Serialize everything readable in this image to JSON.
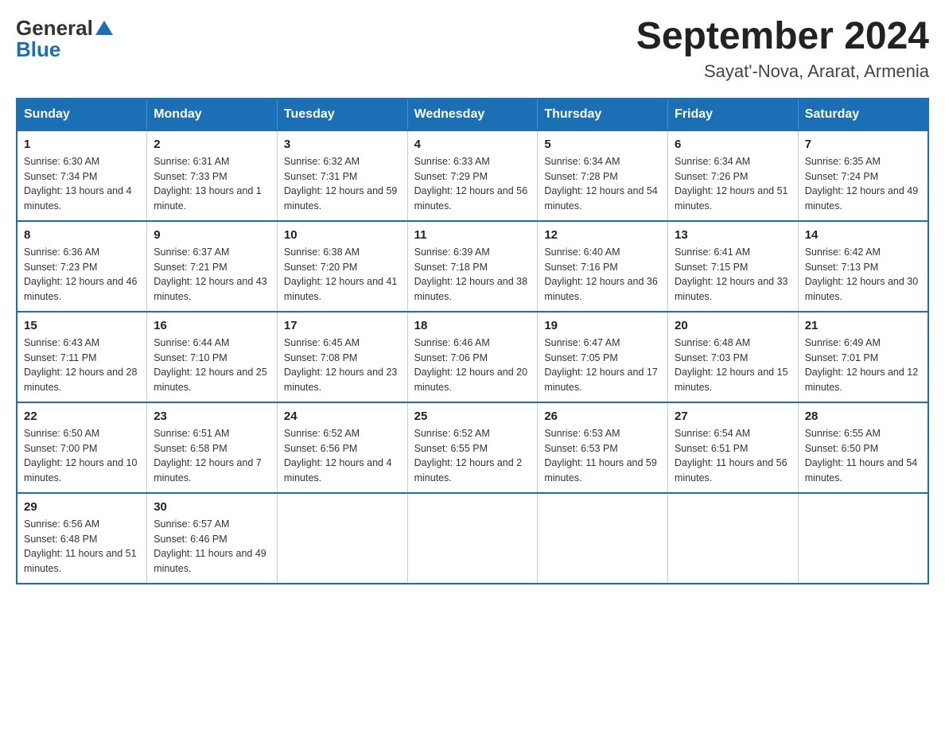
{
  "logo": {
    "general": "General",
    "blue": "Blue"
  },
  "title": "September 2024",
  "location": "Sayat'-Nova, Ararat, Armenia",
  "days_header": [
    "Sunday",
    "Monday",
    "Tuesday",
    "Wednesday",
    "Thursday",
    "Friday",
    "Saturday"
  ],
  "weeks": [
    [
      {
        "day": "1",
        "sunrise": "Sunrise: 6:30 AM",
        "sunset": "Sunset: 7:34 PM",
        "daylight": "Daylight: 13 hours and 4 minutes."
      },
      {
        "day": "2",
        "sunrise": "Sunrise: 6:31 AM",
        "sunset": "Sunset: 7:33 PM",
        "daylight": "Daylight: 13 hours and 1 minute."
      },
      {
        "day": "3",
        "sunrise": "Sunrise: 6:32 AM",
        "sunset": "Sunset: 7:31 PM",
        "daylight": "Daylight: 12 hours and 59 minutes."
      },
      {
        "day": "4",
        "sunrise": "Sunrise: 6:33 AM",
        "sunset": "Sunset: 7:29 PM",
        "daylight": "Daylight: 12 hours and 56 minutes."
      },
      {
        "day": "5",
        "sunrise": "Sunrise: 6:34 AM",
        "sunset": "Sunset: 7:28 PM",
        "daylight": "Daylight: 12 hours and 54 minutes."
      },
      {
        "day": "6",
        "sunrise": "Sunrise: 6:34 AM",
        "sunset": "Sunset: 7:26 PM",
        "daylight": "Daylight: 12 hours and 51 minutes."
      },
      {
        "day": "7",
        "sunrise": "Sunrise: 6:35 AM",
        "sunset": "Sunset: 7:24 PM",
        "daylight": "Daylight: 12 hours and 49 minutes."
      }
    ],
    [
      {
        "day": "8",
        "sunrise": "Sunrise: 6:36 AM",
        "sunset": "Sunset: 7:23 PM",
        "daylight": "Daylight: 12 hours and 46 minutes."
      },
      {
        "day": "9",
        "sunrise": "Sunrise: 6:37 AM",
        "sunset": "Sunset: 7:21 PM",
        "daylight": "Daylight: 12 hours and 43 minutes."
      },
      {
        "day": "10",
        "sunrise": "Sunrise: 6:38 AM",
        "sunset": "Sunset: 7:20 PM",
        "daylight": "Daylight: 12 hours and 41 minutes."
      },
      {
        "day": "11",
        "sunrise": "Sunrise: 6:39 AM",
        "sunset": "Sunset: 7:18 PM",
        "daylight": "Daylight: 12 hours and 38 minutes."
      },
      {
        "day": "12",
        "sunrise": "Sunrise: 6:40 AM",
        "sunset": "Sunset: 7:16 PM",
        "daylight": "Daylight: 12 hours and 36 minutes."
      },
      {
        "day": "13",
        "sunrise": "Sunrise: 6:41 AM",
        "sunset": "Sunset: 7:15 PM",
        "daylight": "Daylight: 12 hours and 33 minutes."
      },
      {
        "day": "14",
        "sunrise": "Sunrise: 6:42 AM",
        "sunset": "Sunset: 7:13 PM",
        "daylight": "Daylight: 12 hours and 30 minutes."
      }
    ],
    [
      {
        "day": "15",
        "sunrise": "Sunrise: 6:43 AM",
        "sunset": "Sunset: 7:11 PM",
        "daylight": "Daylight: 12 hours and 28 minutes."
      },
      {
        "day": "16",
        "sunrise": "Sunrise: 6:44 AM",
        "sunset": "Sunset: 7:10 PM",
        "daylight": "Daylight: 12 hours and 25 minutes."
      },
      {
        "day": "17",
        "sunrise": "Sunrise: 6:45 AM",
        "sunset": "Sunset: 7:08 PM",
        "daylight": "Daylight: 12 hours and 23 minutes."
      },
      {
        "day": "18",
        "sunrise": "Sunrise: 6:46 AM",
        "sunset": "Sunset: 7:06 PM",
        "daylight": "Daylight: 12 hours and 20 minutes."
      },
      {
        "day": "19",
        "sunrise": "Sunrise: 6:47 AM",
        "sunset": "Sunset: 7:05 PM",
        "daylight": "Daylight: 12 hours and 17 minutes."
      },
      {
        "day": "20",
        "sunrise": "Sunrise: 6:48 AM",
        "sunset": "Sunset: 7:03 PM",
        "daylight": "Daylight: 12 hours and 15 minutes."
      },
      {
        "day": "21",
        "sunrise": "Sunrise: 6:49 AM",
        "sunset": "Sunset: 7:01 PM",
        "daylight": "Daylight: 12 hours and 12 minutes."
      }
    ],
    [
      {
        "day": "22",
        "sunrise": "Sunrise: 6:50 AM",
        "sunset": "Sunset: 7:00 PM",
        "daylight": "Daylight: 12 hours and 10 minutes."
      },
      {
        "day": "23",
        "sunrise": "Sunrise: 6:51 AM",
        "sunset": "Sunset: 6:58 PM",
        "daylight": "Daylight: 12 hours and 7 minutes."
      },
      {
        "day": "24",
        "sunrise": "Sunrise: 6:52 AM",
        "sunset": "Sunset: 6:56 PM",
        "daylight": "Daylight: 12 hours and 4 minutes."
      },
      {
        "day": "25",
        "sunrise": "Sunrise: 6:52 AM",
        "sunset": "Sunset: 6:55 PM",
        "daylight": "Daylight: 12 hours and 2 minutes."
      },
      {
        "day": "26",
        "sunrise": "Sunrise: 6:53 AM",
        "sunset": "Sunset: 6:53 PM",
        "daylight": "Daylight: 11 hours and 59 minutes."
      },
      {
        "day": "27",
        "sunrise": "Sunrise: 6:54 AM",
        "sunset": "Sunset: 6:51 PM",
        "daylight": "Daylight: 11 hours and 56 minutes."
      },
      {
        "day": "28",
        "sunrise": "Sunrise: 6:55 AM",
        "sunset": "Sunset: 6:50 PM",
        "daylight": "Daylight: 11 hours and 54 minutes."
      }
    ],
    [
      {
        "day": "29",
        "sunrise": "Sunrise: 6:56 AM",
        "sunset": "Sunset: 6:48 PM",
        "daylight": "Daylight: 11 hours and 51 minutes."
      },
      {
        "day": "30",
        "sunrise": "Sunrise: 6:57 AM",
        "sunset": "Sunset: 6:46 PM",
        "daylight": "Daylight: 11 hours and 49 minutes."
      },
      null,
      null,
      null,
      null,
      null
    ]
  ]
}
